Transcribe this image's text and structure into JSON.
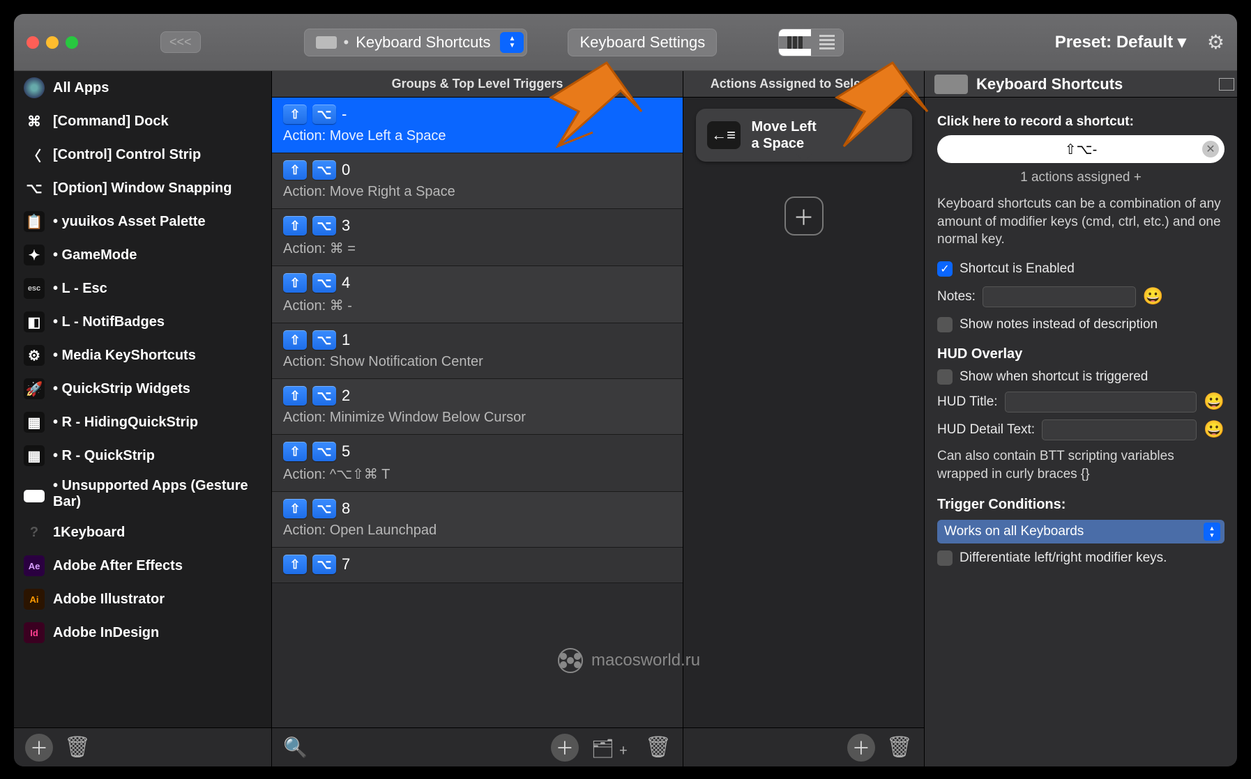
{
  "toolbar": {
    "back_label": "<<<",
    "dropdown_label": "Keyboard Shortcuts",
    "settings_label": "Keyboard Settings",
    "preset_label": "Preset: Default ▾"
  },
  "columns": {
    "triggers_header": "Groups & Top Level Triggers",
    "actions_header": "Actions Assigned to Selected...",
    "inspector_header": "Keyboard Shortcuts"
  },
  "sidebar": {
    "items": [
      {
        "label": "All Apps",
        "icon": "globe"
      },
      {
        "label": "[Command] Dock",
        "icon": "⌘"
      },
      {
        "label": "[Control] Control Strip",
        "icon": "∧"
      },
      {
        "label": "[Option] Window Snapping",
        "icon": "⌥"
      },
      {
        "label": "• yuuikos Asset Palette",
        "icon": "📋"
      },
      {
        "label": "• GameMode",
        "icon": "✦"
      },
      {
        "label": "• L - Esc",
        "icon": "esc"
      },
      {
        "label": "• L - NotifBadges",
        "icon": "◧"
      },
      {
        "label": "• Media KeyShortcuts",
        "icon": "⚙"
      },
      {
        "label": "• QuickStrip Widgets",
        "icon": "🚀"
      },
      {
        "label": "• R - HidingQuickStrip",
        "icon": "▦"
      },
      {
        "label": "• R - QuickStrip",
        "icon": "▦"
      },
      {
        "label": "• Unsupported Apps (Gesture Bar)",
        "icon": "▬"
      },
      {
        "label": "1Keyboard",
        "icon": "?"
      },
      {
        "label": "Adobe After Effects",
        "icon": "Ae"
      },
      {
        "label": "Adobe Illustrator",
        "icon": "Ai"
      },
      {
        "label": "Adobe InDesign",
        "icon": "Id"
      }
    ]
  },
  "triggers": [
    {
      "key": "-",
      "action": "Action: Move Left a Space",
      "selected": true
    },
    {
      "key": "0",
      "action": "Action: Move Right a Space"
    },
    {
      "key": "3",
      "action": "Action: ⌘ ="
    },
    {
      "key": "4",
      "action": "Action: ⌘ -"
    },
    {
      "key": "1",
      "action": "Action: Show Notification Center"
    },
    {
      "key": "2",
      "action": "Action: Minimize Window Below Cursor"
    },
    {
      "key": "5",
      "action": "Action: ^⌥⇧⌘ T"
    },
    {
      "key": "8",
      "action": "Action: Open Launchpad"
    },
    {
      "key": "7",
      "action": ""
    }
  ],
  "action_card": {
    "title": "Move Left\na Space"
  },
  "inspector": {
    "record_label": "Click here to record a shortcut:",
    "recorded": "⇧⌥-",
    "assigned": "1 actions assigned +",
    "help": "Keyboard shortcuts can be a combination of any amount of modifier keys (cmd, ctrl, etc.) and one normal key.",
    "enabled_label": "Shortcut is Enabled",
    "notes_label": "Notes:",
    "show_notes_label": "Show notes instead of description",
    "hud_header": "HUD Overlay",
    "hud_show_label": "Show when shortcut is triggered",
    "hud_title_label": "HUD Title:",
    "hud_detail_label": "HUD Detail Text:",
    "hud_note": "Can also contain BTT scripting variables wrapped in curly braces {}",
    "cond_header": "Trigger Conditions:",
    "cond_value": "Works on all Keyboards",
    "diff_label": "Differentiate left/right modifier keys."
  },
  "watermark": "macosworld.ru"
}
